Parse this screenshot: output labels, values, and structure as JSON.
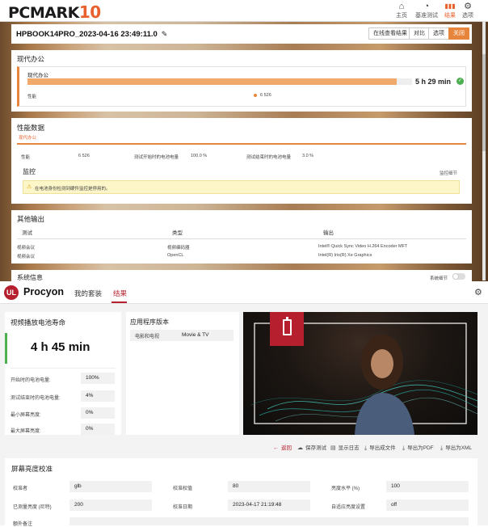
{
  "pcmark": {
    "logo_main": "PCMARK",
    "logo_num": "10",
    "nav": [
      {
        "label": "主页",
        "icon": "home-icon",
        "glyph": "⌂"
      },
      {
        "label": "基准测试",
        "icon": "gauge-icon",
        "glyph": "◔"
      },
      {
        "label": "结果",
        "icon": "bar-chart-icon",
        "glyph": "▮▮"
      },
      {
        "label": "选项",
        "icon": "gear-icon",
        "glyph": "⚙"
      }
    ],
    "result_title": "HPBOOK14PRO_2023-04-16 23:49:11.0",
    "buttons": {
      "online": "在线查看结果",
      "compare": "对比",
      "options": "选项",
      "close": "关闭"
    },
    "modern_office": {
      "section_title": "现代办公",
      "inner_label": "现代办公",
      "score_label": "5 h 29 min",
      "progress_fraction": 0.96,
      "perf_label": "性能",
      "perf_value": "6 526"
    },
    "perf_data": {
      "title": "性能数据",
      "tab": "现代办公",
      "rows": {
        "perf_label": "性能",
        "perf_value": "6 526",
        "start_label": "测试开始时的电池电量",
        "start_value": "100.0 %",
        "end_label": "测试结束时的电池电量",
        "end_value": "3.0 %"
      },
      "monitor_title": "监控",
      "monitor_details": "监控细节",
      "warning": "在电池身份检测到硬件监控是停用的。"
    },
    "other_output": {
      "title": "其他输出",
      "headers": [
        "测试",
        "类型",
        "输出"
      ],
      "rows": [
        [
          "视频会议",
          "视频编码器",
          "Intel® Quick Sync Video H.264 Encoder MFT"
        ],
        [
          "视频会议",
          "OpenCL",
          "Intel(R) Iris(R) Xe Graphics"
        ]
      ]
    },
    "system_info": {
      "title": "系统信息",
      "details_label": "系统细节"
    }
  },
  "procyon": {
    "logo_mark": "UL",
    "logo_word": "Procyon",
    "tabs": [
      "我的套装",
      "结果"
    ],
    "battery": {
      "title": "视频播放电池寿命",
      "score": "4 h 45 min",
      "rows": [
        {
          "label": "开始时的电池电量:",
          "value": "100%"
        },
        {
          "label": "测试结束时的电池电量:",
          "value": "4%"
        },
        {
          "label": "最小屏幕亮度:",
          "value": "0%"
        },
        {
          "label": "最大屏幕亮度:",
          "value": "0%"
        }
      ]
    },
    "app_version": {
      "title": "应用程序版本",
      "label": "电影和电视",
      "value": "Movie & TV"
    },
    "actions": [
      "返回",
      "保存测试",
      "显示日志",
      "导出成文件",
      "导出为PDF",
      "导出为XML"
    ],
    "brightness": {
      "title": "屏幕亮度校准",
      "fields": [
        {
          "label": "校准者",
          "value": "glb"
        },
        {
          "label": "校准权值",
          "value": "80"
        },
        {
          "label": "亮度水平 (%)",
          "value": "100"
        },
        {
          "label": "已测量亮度 (尼特)",
          "value": "200"
        },
        {
          "label": "校准日期",
          "value": "2023-04-17 21:19:48"
        },
        {
          "label": "自适应亮度设置",
          "value": "off"
        }
      ],
      "notes_label": "额外备注"
    }
  },
  "colors": {
    "pcmark_accent": "#e8612c",
    "progress": "#f0a96b",
    "procyon_red": "#b6202e",
    "battery_green": "#4caf50"
  }
}
